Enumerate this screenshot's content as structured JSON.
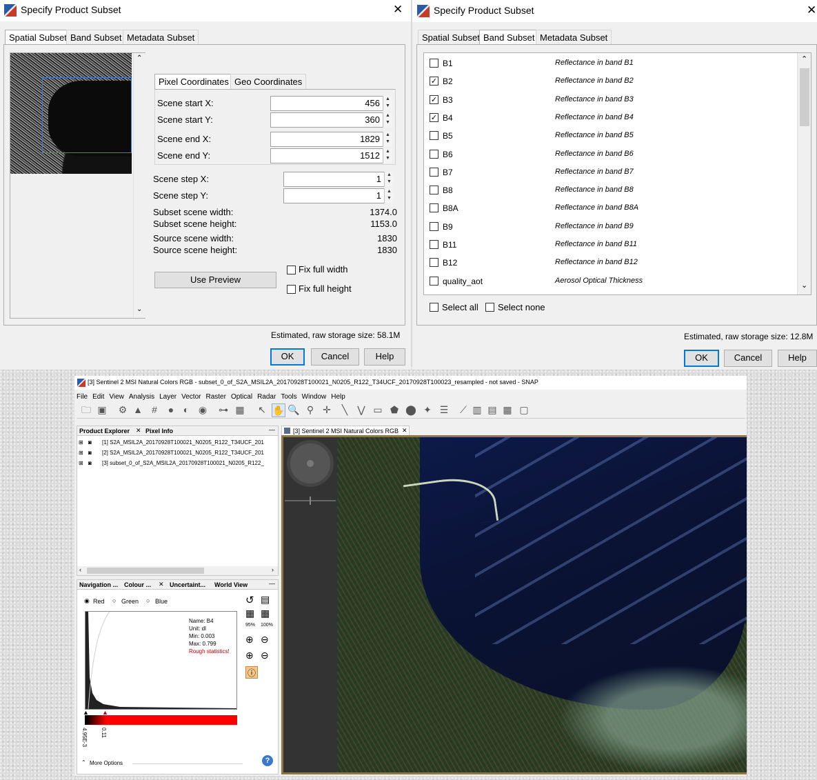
{
  "left_dialog": {
    "title": "Specify Product Subset",
    "close": "✕",
    "tabs": [
      "Spatial Subset",
      "Band Subset",
      "Metadata Subset"
    ],
    "coord_tabs": [
      "Pixel Coordinates",
      "Geo Coordinates"
    ],
    "fields": [
      {
        "label": "Scene start X:",
        "value": "456"
      },
      {
        "label": "Scene start Y:",
        "value": "360"
      },
      {
        "label": "Scene end X:",
        "value": "1829"
      },
      {
        "label": "Scene end Y:",
        "value": "1512"
      }
    ],
    "steps": [
      {
        "label": "Scene step X:",
        "value": "1"
      },
      {
        "label": "Scene step Y:",
        "value": "1"
      }
    ],
    "info": [
      {
        "label": "Subset scene width:",
        "value": "1374.0"
      },
      {
        "label": "Subset scene height:",
        "value": "1153.0"
      },
      {
        "label": "Source scene width:",
        "value": "1830"
      },
      {
        "label": "Source scene height:",
        "value": "1830"
      }
    ],
    "use_preview": "Use Preview",
    "fix_width": "Fix full width",
    "fix_height": "Fix full height",
    "storage": "Estimated, raw storage size: 58.1M",
    "ok": "OK",
    "cancel": "Cancel",
    "help": "Help"
  },
  "right_dialog": {
    "title": "Specify Product Subset",
    "close": "✕",
    "tabs": [
      "Spatial Subset",
      "Band Subset",
      "Metadata Subset"
    ],
    "bands": [
      {
        "name": "B1",
        "desc": "Reflectance in band B1",
        "checked": false
      },
      {
        "name": "B2",
        "desc": "Reflectance in band B2",
        "checked": true
      },
      {
        "name": "B3",
        "desc": "Reflectance in band B3",
        "checked": true
      },
      {
        "name": "B4",
        "desc": "Reflectance in band B4",
        "checked": true
      },
      {
        "name": "B5",
        "desc": "Reflectance in band B5",
        "checked": false
      },
      {
        "name": "B6",
        "desc": "Reflectance in band B6",
        "checked": false
      },
      {
        "name": "B7",
        "desc": "Reflectance in band B7",
        "checked": false
      },
      {
        "name": "B8",
        "desc": "Reflectance in band B8",
        "checked": false
      },
      {
        "name": "B8A",
        "desc": "Reflectance in band B8A",
        "checked": false
      },
      {
        "name": "B9",
        "desc": "Reflectance in band B9",
        "checked": false
      },
      {
        "name": "B11",
        "desc": "Reflectance in band B11",
        "checked": false
      },
      {
        "name": "B12",
        "desc": "Reflectance in band B12",
        "checked": false
      },
      {
        "name": "quality_aot",
        "desc": "Aerosol Optical Thickness",
        "checked": false
      }
    ],
    "select_all": "Select all",
    "select_none": "Select none",
    "storage": "Estimated, raw storage size: 12.8M",
    "ok": "OK",
    "cancel": "Cancel",
    "help": "Help"
  },
  "snap": {
    "title": "[3] Sentinel 2 MSI Natural Colors RGB - subset_0_of_S2A_MSIL2A_20170928T100021_N0205_R122_T34UCF_20170928T100023_resampled - not saved - SNAP",
    "menu": [
      "File",
      "Edit",
      "View",
      "Analysis",
      "Layer",
      "Vector",
      "Raster",
      "Optical",
      "Radar",
      "Tools",
      "Window",
      "Help"
    ],
    "explorer_tabs": [
      "Product Explorer",
      "Pixel Info"
    ],
    "products": [
      "[1] S2A_MSIL2A_20170928T100021_N0205_R122_T34UCF_201",
      "[2] S2A_MSIL2A_20170928T100021_N0205_R122_T34UCF_201",
      "[3] subset_0_of_S2A_MSIL2A_20170928T100021_N0205_R122_"
    ],
    "bottom_tabs": [
      "Navigation ...",
      "Colour ...",
      "Uncertaint...",
      "World View"
    ],
    "channels": [
      "Red",
      "Green",
      "Blue"
    ],
    "stats": {
      "name": "Name: B4",
      "unit": "Unit: dl",
      "min": "Min: 0.003",
      "max": "Max: 0.799",
      "rough": "Rough statistics!"
    },
    "pct_95": "95%",
    "pct_100": "100%",
    "slider_min": "4.95E-3",
    "slider_max": "0.11",
    "more_options": "More Options",
    "view_tab": "[3] Sentinel 2 MSI Natural Colors RGB",
    "colors": {
      "accent": "#0078d7",
      "red": "#ff0000",
      "rough": "#c00000",
      "frame": "#8a7a4a"
    }
  }
}
